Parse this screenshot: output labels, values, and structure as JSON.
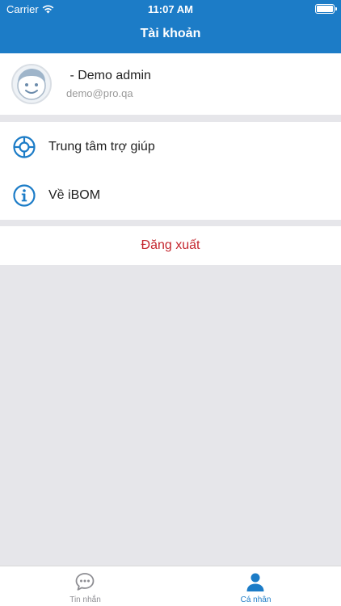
{
  "status_bar": {
    "carrier": "Carrier",
    "time": "11:07 AM"
  },
  "nav": {
    "title": "Tài khoản"
  },
  "profile": {
    "name": " - Demo admin",
    "email": "demo@pro.qa"
  },
  "menu": {
    "items": [
      {
        "label": "Trung tâm trợ giúp",
        "icon": "lifebuoy-icon"
      },
      {
        "label": "Về iBOM",
        "icon": "info-icon"
      }
    ]
  },
  "logout": {
    "label": "Đăng xuất"
  },
  "tabs": [
    {
      "label": "Tin nhắn",
      "icon": "chat-bubble-icon",
      "active": false
    },
    {
      "label": "Cá nhân",
      "icon": "person-icon",
      "active": true
    }
  ],
  "colors": {
    "brand": "#1c7cc7",
    "logout": "#c4262e",
    "background": "#e6e6ea",
    "tab_inactive": "#8e8e93"
  }
}
